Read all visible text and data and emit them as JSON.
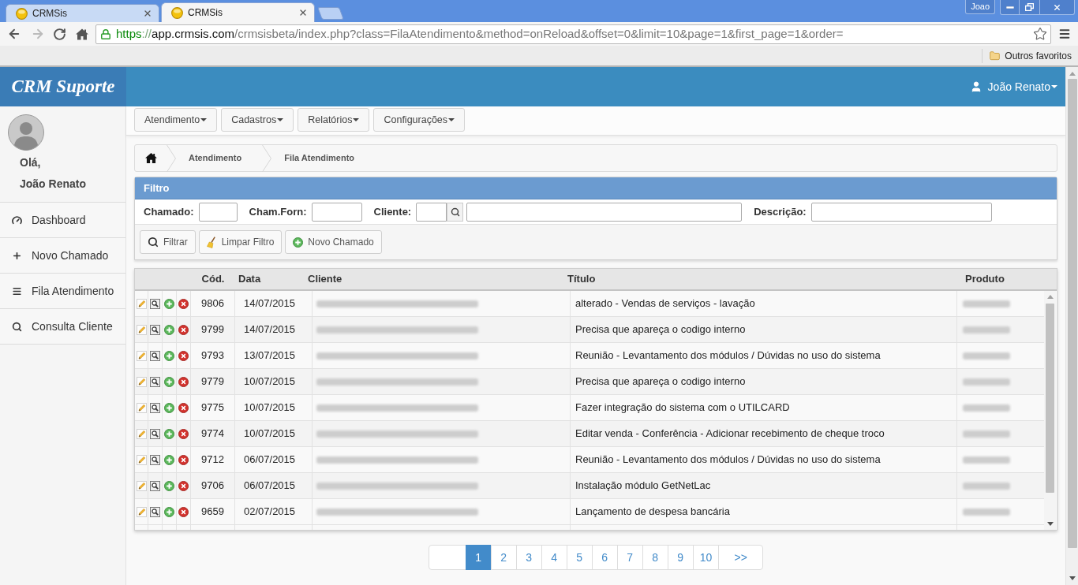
{
  "browser": {
    "tabs": [
      {
        "title": "CRMSis",
        "selected": false
      },
      {
        "title": "CRMSis",
        "selected": true
      }
    ],
    "profile_button": "Joao",
    "address": {
      "scheme": "https",
      "separator": "://",
      "host": "app.crmsis.com",
      "path": "/crmsisbeta/index.php?class=FilaAtendimento&method=onReload&offset=0&limit=10&page=1&first_page=1&order="
    },
    "bookmarks": [
      "Outros favoritos"
    ]
  },
  "header": {
    "logo": "CRM Suporte",
    "user": "João Renato"
  },
  "sidebar": {
    "greeting": "Olá,",
    "user_name": "João Renato",
    "items": [
      "Dashboard",
      "Novo Chamado",
      "Fila Atendimento",
      "Consulta Cliente"
    ]
  },
  "menu": [
    "Atendimento",
    "Cadastros",
    "Relatórios",
    "Configurações"
  ],
  "breadcrumb": [
    "Atendimento",
    "Fila Atendimento"
  ],
  "filter": {
    "title": "Filtro",
    "fields": [
      {
        "label": "Chamado:",
        "kind": "short"
      },
      {
        "label": "Cham.Forn:",
        "kind": "medium"
      },
      {
        "label": "Cliente:",
        "kind": "lookup"
      },
      {
        "label": "Descrição:",
        "kind": "wide"
      }
    ],
    "buttons": [
      "Filtrar",
      "Limpar Filtro",
      "Novo Chamado"
    ]
  },
  "table": {
    "columns": [
      "Cód.",
      "Data",
      "Cliente",
      "Título",
      "Produto"
    ],
    "rows": [
      {
        "code": "9806",
        "date": "14/07/2015",
        "title": "alterado - Vendas de serviços - lavação"
      },
      {
        "code": "9799",
        "date": "14/07/2015",
        "title": "Precisa que apareça o codigo interno"
      },
      {
        "code": "9793",
        "date": "13/07/2015",
        "title": "Reunião - Levantamento dos módulos / Dúvidas no uso do sistema"
      },
      {
        "code": "9779",
        "date": "10/07/2015",
        "title": "Precisa que apareça o codigo interno"
      },
      {
        "code": "9775",
        "date": "10/07/2015",
        "title": "Fazer integração do sistema com o UTILCARD"
      },
      {
        "code": "9774",
        "date": "10/07/2015",
        "title": "Editar venda - Conferência - Adicionar recebimento de cheque troco"
      },
      {
        "code": "9712",
        "date": "06/07/2015",
        "title": "Reunião - Levantamento dos módulos / Dúvidas no uso do sistema"
      },
      {
        "code": "9706",
        "date": "06/07/2015",
        "title": "Instalação módulo GetNetLac"
      },
      {
        "code": "9659",
        "date": "02/07/2015",
        "title": "Lançamento de despesa bancária"
      }
    ]
  },
  "pagination": {
    "pages": [
      {
        "label": "1",
        "selected": true
      },
      {
        "label": "2",
        "selected": false
      },
      {
        "label": "3",
        "selected": false
      },
      {
        "label": "4",
        "selected": false
      },
      {
        "label": "5",
        "selected": false
      },
      {
        "label": "6",
        "selected": false
      },
      {
        "label": "7",
        "selected": false
      },
      {
        "label": "8",
        "selected": false
      },
      {
        "label": "9",
        "selected": false
      },
      {
        "label": "10",
        "selected": false
      }
    ],
    "next": ">>"
  }
}
